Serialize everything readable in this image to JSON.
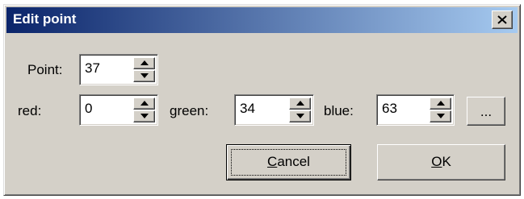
{
  "colors": {
    "titlebar_start": "#0a246a",
    "titlebar_end": "#a6caf0",
    "face": "#d4d0c8"
  },
  "dialog": {
    "title": "Edit point",
    "close_icon": "close-icon"
  },
  "fields": {
    "point": {
      "label": "Point:",
      "value": "37"
    },
    "red": {
      "label": "red:",
      "value": "0"
    },
    "green": {
      "label": "green:",
      "value": "34"
    },
    "blue": {
      "label": "blue:",
      "value": "63"
    }
  },
  "buttons": {
    "browse": "...",
    "cancel": {
      "mnemonic": "C",
      "rest": "ancel"
    },
    "ok": {
      "mnemonic": "O",
      "rest": "K"
    }
  }
}
